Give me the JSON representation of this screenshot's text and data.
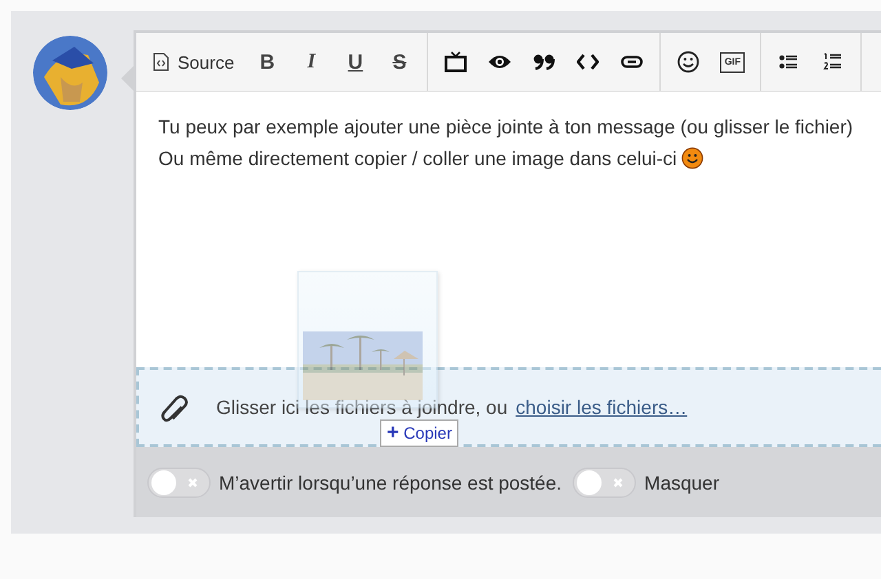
{
  "toolbar": {
    "groups": [
      [
        {
          "kind": "source",
          "label": "Source"
        },
        {
          "kind": "bold",
          "label": "B"
        },
        {
          "kind": "italic",
          "label": "I"
        },
        {
          "kind": "underline",
          "label": "U"
        },
        {
          "kind": "strike",
          "label": "S"
        }
      ],
      [
        {
          "kind": "tv"
        },
        {
          "kind": "eye"
        },
        {
          "kind": "quote"
        },
        {
          "kind": "code"
        },
        {
          "kind": "link"
        }
      ],
      [
        {
          "kind": "smiley"
        },
        {
          "kind": "gif",
          "label": "GIF"
        }
      ],
      [
        {
          "kind": "bullets"
        },
        {
          "kind": "numbers"
        }
      ]
    ]
  },
  "editor": {
    "lines": [
      "Tu peux par exemple ajouter une pièce jointe à ton message (ou glisser le fichier)",
      "Ou même directement copier / coller une image dans celui-ci"
    ]
  },
  "attachments": {
    "text": "Glisser ici les fichiers à joindre, ou",
    "link": "choisir les fichiers…"
  },
  "drag_preview": {
    "kind": "picture",
    "action_icon": "+",
    "action": "Copier"
  },
  "options": [
    {
      "label": "M’avertir lorsqu’une réponse est postée.",
      "checked": false
    },
    {
      "label": "Masquer",
      "checked": false
    }
  ]
}
